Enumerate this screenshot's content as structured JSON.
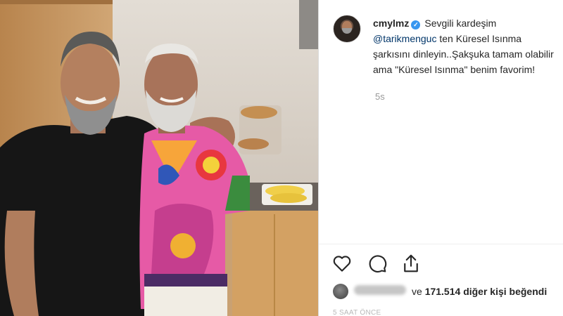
{
  "post": {
    "username": "cmylmz",
    "verified_mark": "✓",
    "caption_lines": [
      "Sevgili kardeşim",
      "ten Küresel Isınma",
      "şarkısını dinleyin..Şakşuka tamam olabilir",
      "ama \"Küresel Isınma\" benim favorim!"
    ],
    "mention": "@tarikmenguc",
    "time_ago": "5s",
    "liker_name": "ramazgazi",
    "likes_connector": "ve",
    "likes_count": "171.514",
    "likes_suffix": "diğer kişi beğendi",
    "date": "5 SAAT ÖNCE",
    "icons": [
      "heart-icon",
      "comment-icon",
      "share-icon",
      "verified-icon"
    ],
    "colors": {
      "text": "#262626",
      "mention": "#003569",
      "verified": "#3897f0",
      "muted": "#999999"
    }
  }
}
